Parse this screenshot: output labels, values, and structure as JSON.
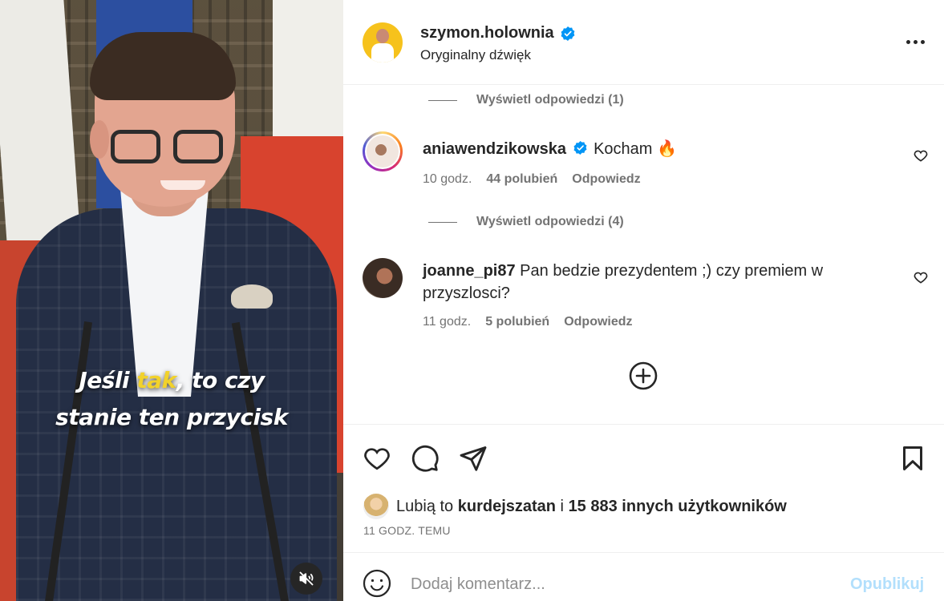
{
  "video": {
    "subtitle_line1_a": "Jeśli ",
    "subtitle_line1_hl": "tak",
    "subtitle_line1_b": ", to czy",
    "subtitle_line2": "stanie ten przycisk",
    "highlight_color": "#f2d22b",
    "mute_icon": "speaker-muted-icon"
  },
  "header": {
    "username": "szymon.holownia",
    "subtitle": "Oryginalny dźwięk",
    "verified_icon": "verified-badge-icon",
    "more_icon": "more-dots-icon"
  },
  "replies_top": {
    "label": "Wyświetl odpowiedzi (1)"
  },
  "comments": [
    {
      "user": "aniawendzikowska",
      "verified": true,
      "text": "Kocham 🔥",
      "time": "10 godz.",
      "likes": "44 polubień",
      "reply": "Odpowiedz",
      "view_replies": "Wyświetl odpowiedzi (4)"
    },
    {
      "user": "joanne_pi87",
      "verified": false,
      "text": "Pan bedzie prezydentem ;) czy premiem w przyszlosci?",
      "time": "11 godz.",
      "likes": "5 polubień",
      "reply": "Odpowiedz"
    }
  ],
  "actions": {
    "like_icon": "heart-icon",
    "comment_icon": "comment-icon",
    "share_icon": "send-icon",
    "save_icon": "bookmark-icon",
    "likes_prefix": "Lubią to ",
    "likes_user": "kurdejszatan",
    "likes_mid": " i ",
    "likes_count": "15 883 innych użytkowników",
    "time_ago": "11 GODZ. TEMU"
  },
  "comment_box": {
    "placeholder": "Dodaj komentarz...",
    "post_label": "Opublikuj",
    "emoji_icon": "emoji-icon"
  },
  "colors": {
    "verified_blue": "#0095f6",
    "muted_text": "#737373",
    "post_disabled": "#b2dffc"
  }
}
